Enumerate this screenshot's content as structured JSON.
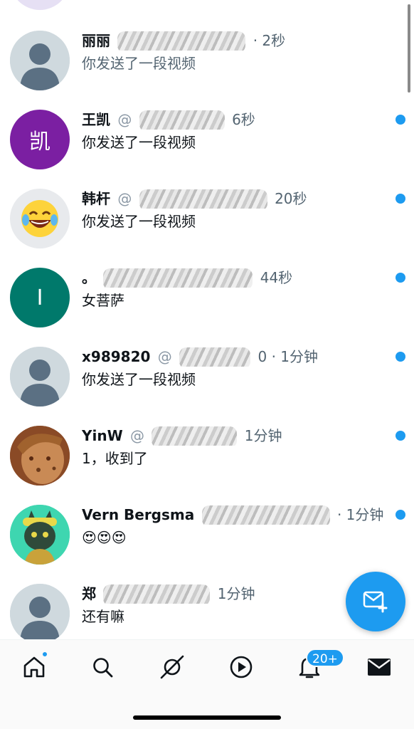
{
  "conversations": [
    {
      "name": "丽丽",
      "handle": "",
      "time": "· 2秒",
      "preview": "你发送了一段视频",
      "unread": false,
      "avatar": "default",
      "preview_faded": true
    },
    {
      "name": "王凯",
      "handle": "@",
      "time": "6秒",
      "preview": "你发送了一段视频",
      "unread": true,
      "avatar": "letter",
      "avatar_letter": "凯",
      "avatar_color": "#7b1fa2"
    },
    {
      "name": "韩杆",
      "handle": "@",
      "time": "20秒",
      "preview": "你发送了一段视频",
      "unread": true,
      "avatar": "emoji",
      "avatar_emoji": "😂"
    },
    {
      "name": "。",
      "handle": "",
      "time": "44秒",
      "preview": "女菩萨",
      "unread": true,
      "avatar": "letter",
      "avatar_letter": "I",
      "avatar_color": "#00796b"
    },
    {
      "name": "x989820",
      "handle": "@",
      "time": "0 · 1分钟",
      "preview": "你发送了一段视频",
      "unread": true,
      "avatar": "default"
    },
    {
      "name": "YinW",
      "handle": "@",
      "time": "1分钟",
      "preview": "1，收到了",
      "unread": true,
      "avatar": "cartoon"
    },
    {
      "name": "Vern Bergsma",
      "handle": "",
      "time": "· 1分钟",
      "preview": "😍😍😍",
      "unread": true,
      "avatar": "cat"
    },
    {
      "name": "郑",
      "handle": "",
      "time": "1分钟",
      "preview": "还有嘛",
      "unread": false,
      "avatar": "default"
    }
  ],
  "fab": {
    "icon": "new-message-icon"
  },
  "tabbar": {
    "tabs": [
      {
        "id": "home",
        "icon": "home-icon",
        "has_dot": true
      },
      {
        "id": "search",
        "icon": "search-icon"
      },
      {
        "id": "spaces",
        "icon": "communities-icon"
      },
      {
        "id": "video",
        "icon": "play-icon"
      },
      {
        "id": "notifications",
        "icon": "bell-icon",
        "badge": "20+"
      },
      {
        "id": "messages",
        "icon": "mail-icon",
        "active": true
      }
    ]
  },
  "colors": {
    "accent": "#1d9bf0",
    "text": "#0f1419",
    "muted": "#536471"
  }
}
